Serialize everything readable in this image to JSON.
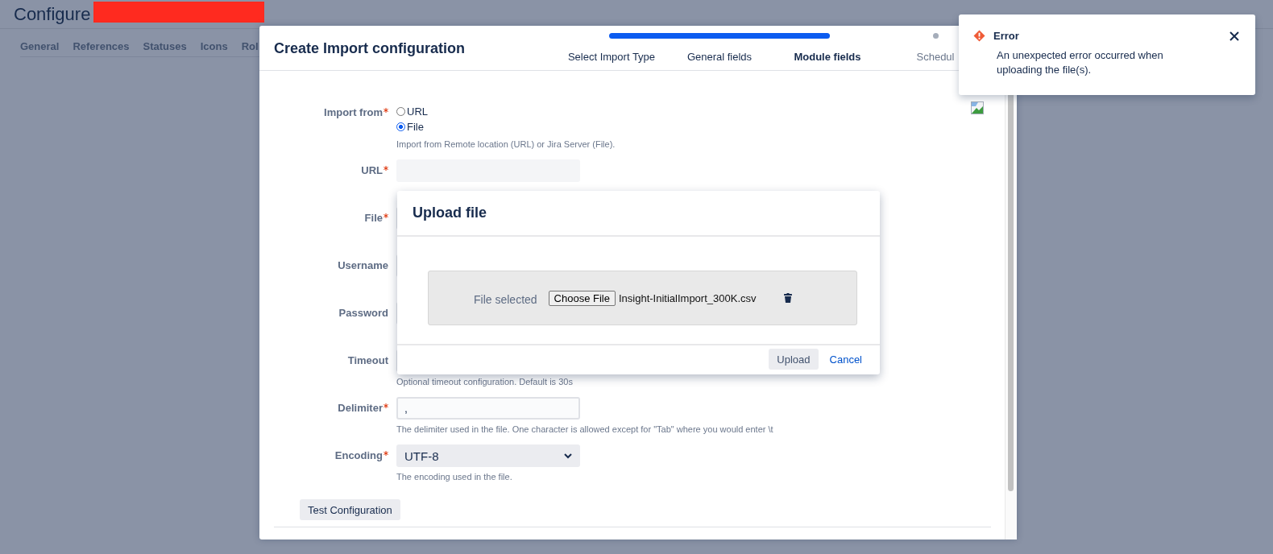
{
  "page": {
    "title": "Configure",
    "tabs": [
      {
        "label": "General"
      },
      {
        "label": "References"
      },
      {
        "label": "Statuses"
      },
      {
        "label": "Icons"
      },
      {
        "label": "Rol"
      }
    ]
  },
  "modal": {
    "title": "Create Import configuration",
    "steps": [
      {
        "label": "Select Import Type",
        "selected": false
      },
      {
        "label": "General fields",
        "selected": false
      },
      {
        "label": "Module fields",
        "selected": true
      },
      {
        "label": "Schedul",
        "selected": false
      }
    ],
    "fields": [
      {
        "kind": "radio",
        "label": "Import from",
        "required": true,
        "options": [
          {
            "label": "URL",
            "selected": false
          },
          {
            "label": "File",
            "selected": true
          }
        ],
        "help": "Import from Remote location (URL) or Jira Server (File)."
      },
      {
        "kind": "text",
        "label": "URL",
        "required": true,
        "disabled": true
      },
      {
        "kind": "text",
        "label": "File",
        "required": true,
        "disabled": false
      },
      {
        "kind": "text",
        "label": "Username",
        "required": false,
        "disabled": false
      },
      {
        "kind": "text",
        "label": "Password",
        "required": false,
        "disabled": false
      },
      {
        "kind": "text",
        "label": "Timeout",
        "required": false,
        "disabled": false,
        "help": "Optional timeout configuration. Default is 30s"
      },
      {
        "kind": "text",
        "label": "Delimiter",
        "required": true,
        "disabled": false,
        "value": ",",
        "help": "The delimiter used in the file. One character is allowed except for \"Tab\" where you would enter \\t"
      },
      {
        "kind": "select",
        "label": "Encoding",
        "required": true,
        "value": "UTF-8",
        "help": "The encoding used in the file."
      }
    ],
    "test_button": "Test Configuration"
  },
  "upload_dialog": {
    "title": "Upload file",
    "file_label": "File selected",
    "choose_button": "Choose File",
    "file_name": "Insight-InitialImport_300K.csv",
    "buttons": [
      {
        "kind": "primary",
        "label": "Upload"
      },
      {
        "kind": "link",
        "label": "Cancel"
      }
    ]
  },
  "toast": {
    "title": "Error",
    "message": "An unexpected error occurred when uploading the file(s)."
  }
}
